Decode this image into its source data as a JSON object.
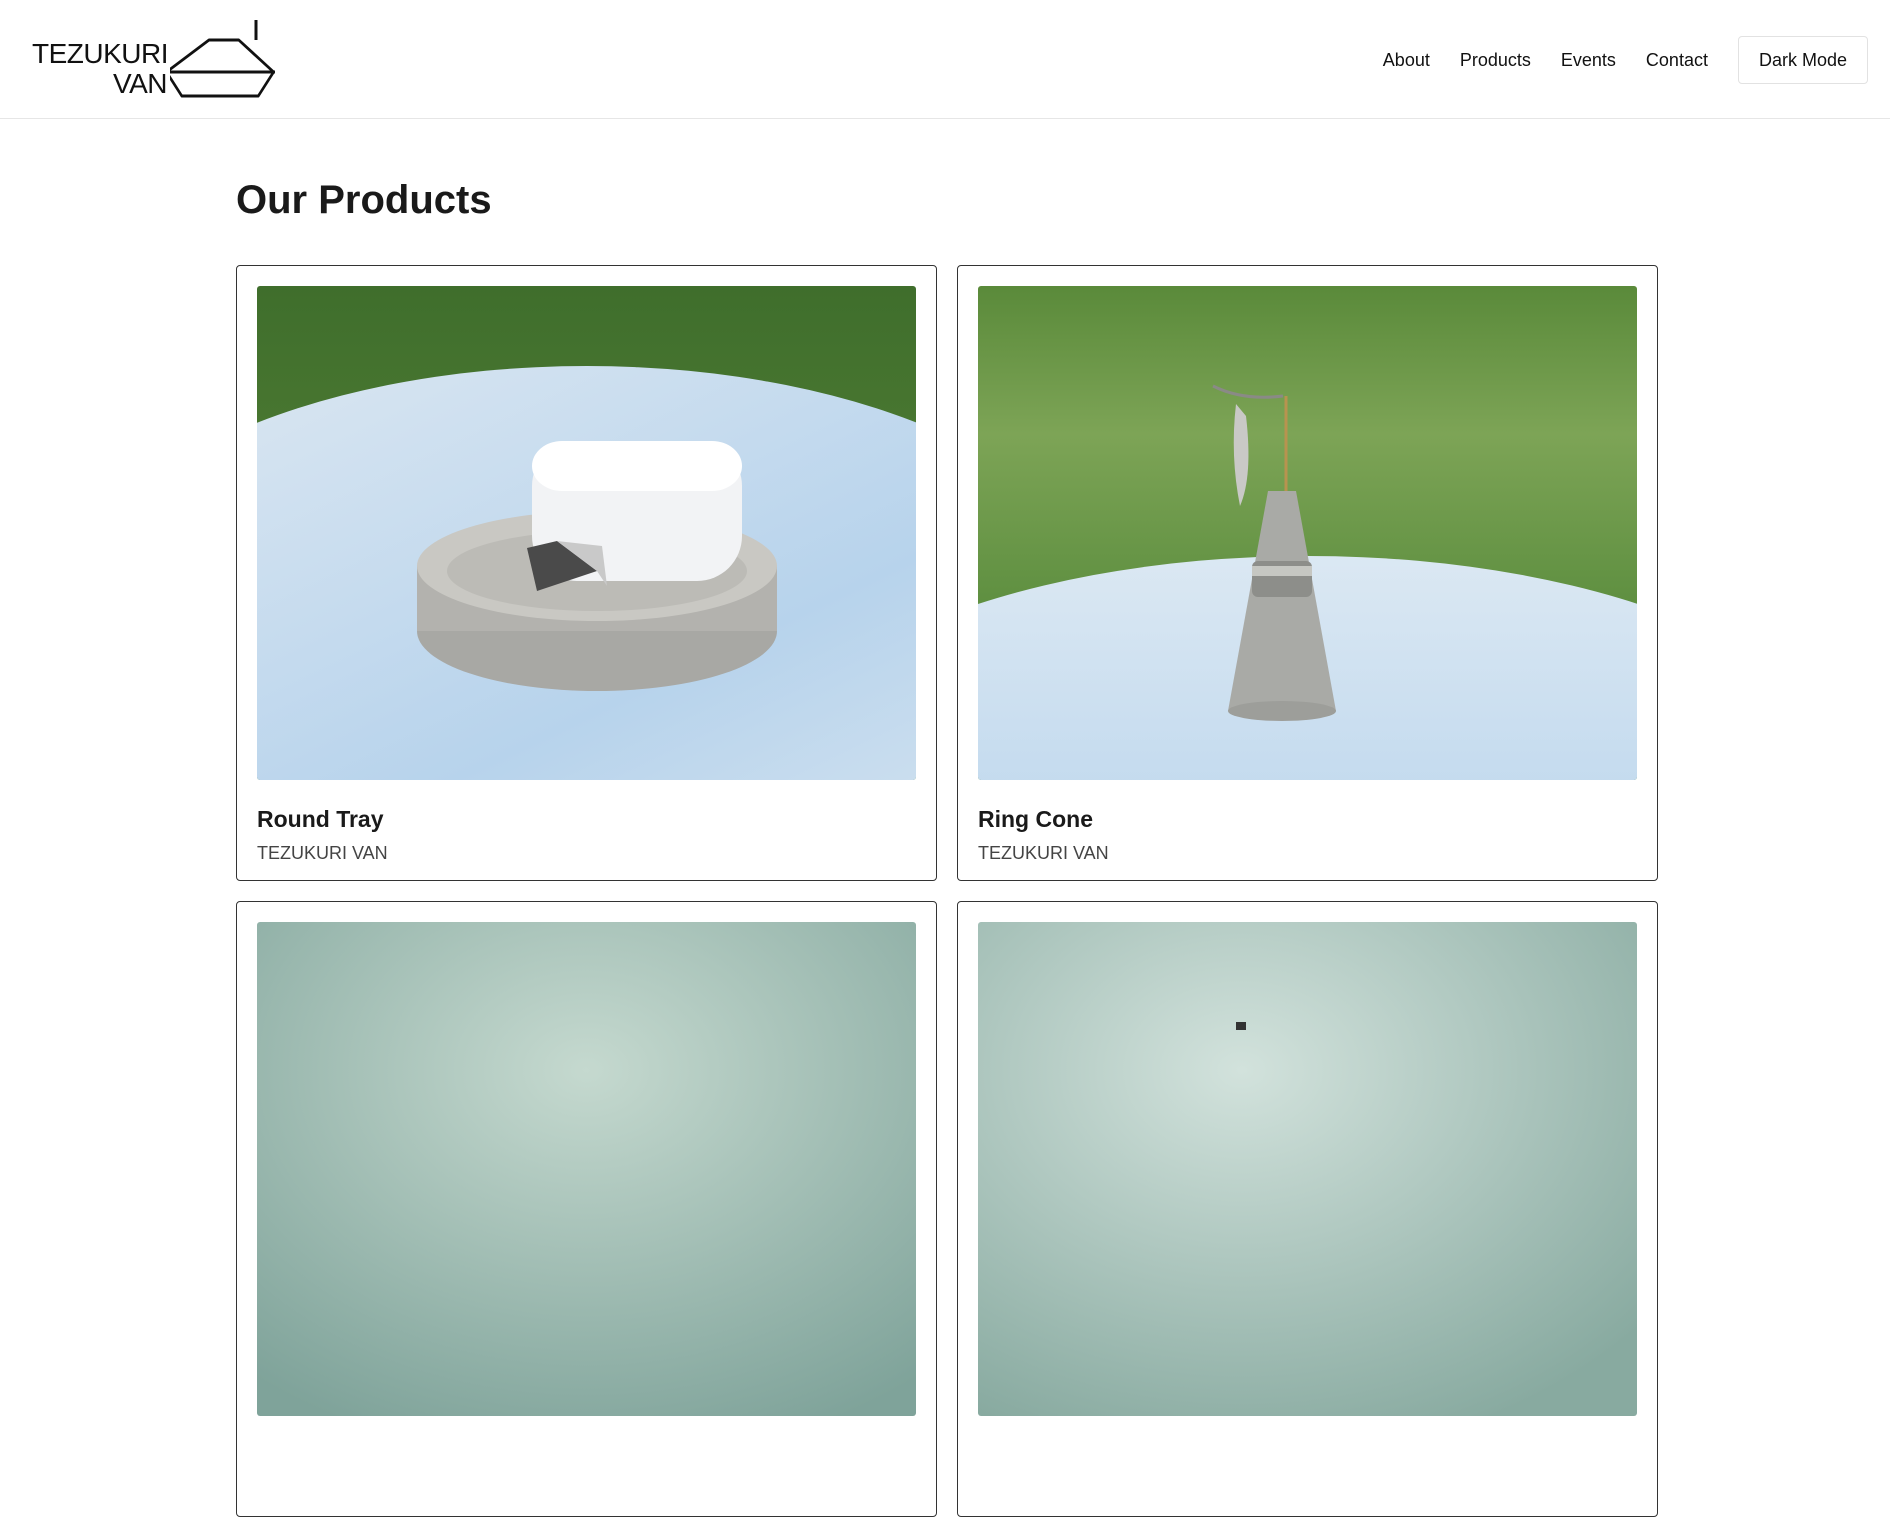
{
  "header": {
    "logo_line1": "TEZUKURI",
    "logo_line2": "VAN",
    "nav": [
      "About",
      "Products",
      "Events",
      "Contact"
    ],
    "dark_mode_label": "Dark Mode"
  },
  "main": {
    "title": "Our Products",
    "products": [
      {
        "name": "Round Tray",
        "brand": "TEZUKURI VAN"
      },
      {
        "name": "Ring Cone",
        "brand": "TEZUKURI VAN"
      },
      {
        "name": "",
        "brand": ""
      },
      {
        "name": "",
        "brand": ""
      }
    ]
  }
}
